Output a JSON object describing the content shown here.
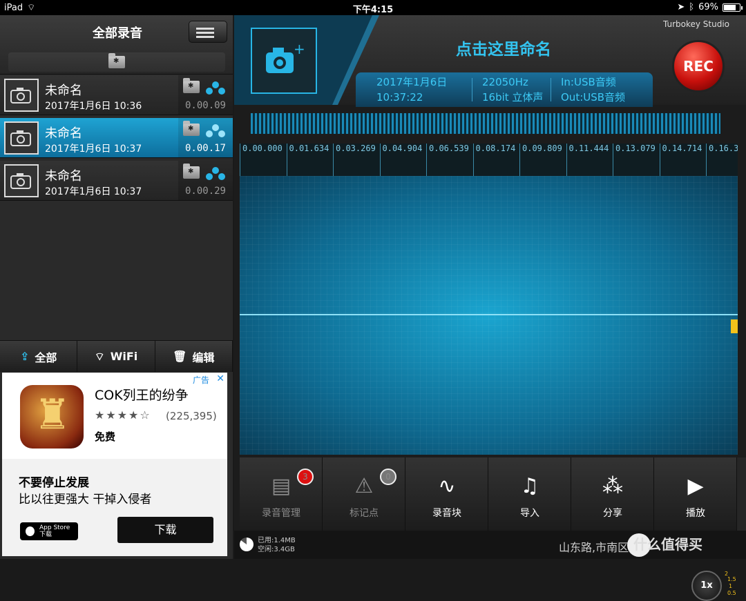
{
  "status": {
    "device": "iPad",
    "time": "下午4:15",
    "battery": "69%",
    "battery_level": 0.69
  },
  "library": {
    "title": "全部录音",
    "recordings": [
      {
        "name": "未命名",
        "date": "2017年1月6日 10:36",
        "duration": "0.00.09"
      },
      {
        "name": "未命名",
        "date": "2017年1月6日 10:37",
        "duration": "0.00.17"
      },
      {
        "name": "未命名",
        "date": "2017年1月6日 10:37",
        "duration": "0.00.29"
      }
    ],
    "toolbar": {
      "all": "全部",
      "wifi": "WiFi",
      "edit": "编辑"
    }
  },
  "ad": {
    "label": "广告",
    "close": "✕",
    "app_name": "COK列王的纷争",
    "stars": "★★★★☆",
    "rating_count": "(225,395)",
    "price": "免费",
    "headline": "不要停止发展",
    "description": "比以往更强大 干掉入侵者",
    "store_line1": "App Store",
    "store_line2": "下载",
    "download": "下载"
  },
  "recorder": {
    "studio": "Turbokey Studio",
    "title": "点击这里命名",
    "date": "2017年1月6日",
    "time": "10:37:22",
    "sample_rate": "22050Hz",
    "format": "16bit 立体声",
    "input": "In:USB音频",
    "output": "Out:USB音频",
    "rec": "REC",
    "timeline": [
      "0.00.000",
      "0.01.634",
      "0.03.269",
      "0.04.904",
      "0.06.539",
      "0.08.174",
      "0.09.809",
      "0.11.444",
      "0.13.079",
      "0.14.714",
      "0.16.3"
    ],
    "speed": "1x",
    "speed_values": [
      "2",
      "1.5",
      "1",
      "0.5"
    ],
    "tools": [
      {
        "label": "录音管理",
        "icon": "archive-icon",
        "badge": "3"
      },
      {
        "label": "标记点",
        "icon": "marker-icon",
        "badge": "0"
      },
      {
        "label": "录音块",
        "icon": "waveform-icon"
      },
      {
        "label": "导入",
        "icon": "music-note-icon"
      },
      {
        "label": "分享",
        "icon": "share-icon"
      },
      {
        "label": "播放",
        "icon": "play-icon"
      }
    ],
    "storage_used": "已用:1.4MB",
    "storage_free": "空闲:3.4GB",
    "location": "山东路,市南区",
    "watermark": "什么值得买"
  },
  "colors": {
    "accent": "#2fc0ee",
    "rec": "#c8100c",
    "ad_blue": "#1c8be0"
  }
}
